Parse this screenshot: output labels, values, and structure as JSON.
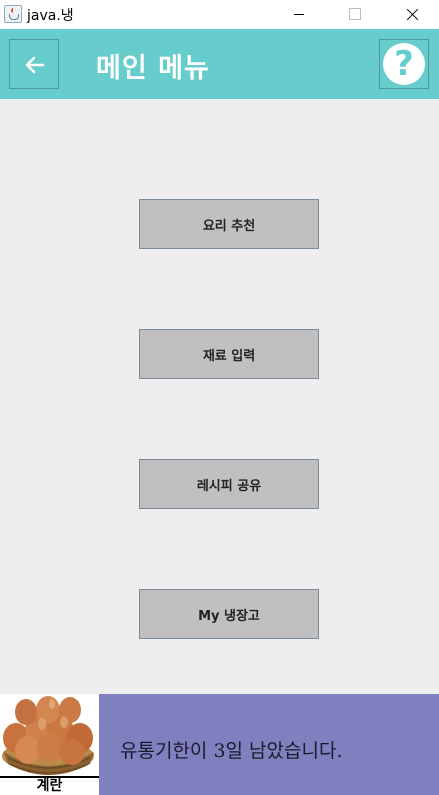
{
  "window": {
    "title": "java.냉",
    "icon": "java-cup-icon"
  },
  "header": {
    "background": "#66cccc",
    "title": "메인 메뉴",
    "back_icon": "arrow-left-icon",
    "help_icon": "question-mark-icon",
    "help_glyph": "?"
  },
  "menu": {
    "buttons": [
      {
        "label": "요리 추천"
      },
      {
        "label": "재료 입력"
      },
      {
        "label": "레시피 공유"
      },
      {
        "label": "My 냉장고"
      }
    ]
  },
  "notice": {
    "image_icon": "egg-basket-icon",
    "item_label": "계란",
    "message": "유통기한이 3일 남았습니다.",
    "background": "#8080c0"
  }
}
